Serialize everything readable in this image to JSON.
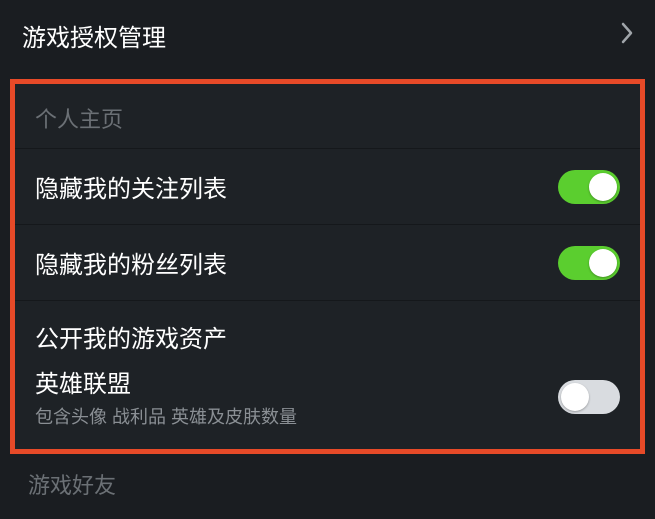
{
  "top": {
    "title": "游戏授权管理"
  },
  "section": {
    "header": "个人主页",
    "items": [
      {
        "label": "隐藏我的关注列表",
        "on": true
      },
      {
        "label": "隐藏我的粉丝列表",
        "on": true
      }
    ],
    "asset_header": "公开我的游戏资产",
    "asset": {
      "name": "英雄联盟",
      "desc": "包含头像 战利品 英雄及皮肤数量",
      "on": false
    }
  },
  "footer": {
    "label": "游戏好友"
  }
}
